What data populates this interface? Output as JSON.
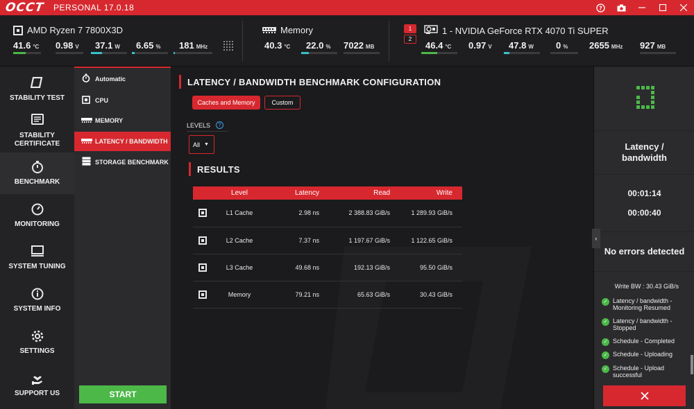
{
  "app": {
    "logo": "OCCT",
    "edition": "PERSONAL 17.0.18"
  },
  "titlebar_icons": [
    "help-icon",
    "camera-icon",
    "minimize-icon",
    "maximize-icon",
    "close-icon"
  ],
  "colors": {
    "accent": "#d7282f",
    "green": "#4cb848",
    "cyan": "#39c2c9",
    "blue_help": "#3aa0e8"
  },
  "hw": {
    "cpu": {
      "name": "AMD Ryzen 7 7800X3D",
      "metrics": [
        {
          "value": "41.6",
          "unit": "°C",
          "fill": 0.45,
          "color": "#4cb848"
        },
        {
          "value": "0.98",
          "unit": "V",
          "fill": 0.0,
          "color": "#39c2c9"
        },
        {
          "value": "37.1",
          "unit": "W",
          "fill": 0.3,
          "color": "#39c2c9"
        },
        {
          "value": "6.65",
          "unit": "%",
          "fill": 0.07,
          "color": "#39c2c9"
        },
        {
          "value": "181",
          "unit": "MHz",
          "fill": 0.04,
          "color": "#39c2c9"
        }
      ]
    },
    "memory": {
      "name": "Memory",
      "metrics": [
        {
          "value": "40.3",
          "unit": "°C",
          "fill": 0.0,
          "color": "#4cb848"
        },
        {
          "value": "22.0",
          "unit": "%",
          "fill": 0.22,
          "color": "#39c2c9"
        },
        {
          "value": "7022",
          "unit": "MB",
          "fill": 0.0,
          "color": "#39c2c9"
        }
      ]
    },
    "gpu": {
      "badges": [
        "1",
        "2"
      ],
      "name": "1 - NVIDIA GeForce RTX 4070 Ti SUPER",
      "metrics": [
        {
          "value": "46.4",
          "unit": "°C",
          "fill": 0.45,
          "color": "#4cb848"
        },
        {
          "value": "0.97",
          "unit": "V",
          "fill": 0.0,
          "color": "#39c2c9"
        },
        {
          "value": "47.8",
          "unit": "W",
          "fill": 0.15,
          "color": "#39c2c9"
        },
        {
          "value": "0",
          "unit": "%",
          "fill": 0.0,
          "color": "#39c2c9"
        },
        {
          "value": "2655",
          "unit": "MHz",
          "fill": 0.0,
          "color": "#39c2c9"
        },
        {
          "value": "927",
          "unit": "MB",
          "fill": 0.0,
          "color": "#39c2c9"
        }
      ]
    }
  },
  "leftnav": [
    {
      "label": "STABILITY TEST",
      "icon": "stability-test-icon"
    },
    {
      "label": "STABILITY CERTIFICATE",
      "icon": "certificate-icon"
    },
    {
      "label": "BENCHMARK",
      "icon": "stopwatch-icon",
      "active": true
    },
    {
      "label": "MONITORING",
      "icon": "gauge-icon"
    },
    {
      "label": "SYSTEM TUNING",
      "icon": "monitor-icon"
    },
    {
      "label": "SYSTEM INFO",
      "icon": "info-icon"
    },
    {
      "label": "SETTINGS",
      "icon": "gear-icon"
    },
    {
      "label": "SUPPORT US",
      "icon": "heart-hand-icon"
    }
  ],
  "subnav": [
    {
      "label": "Automatic",
      "icon": "stopwatch-icon"
    },
    {
      "label": "CPU",
      "icon": "cpu-icon"
    },
    {
      "label": "MEMORY",
      "icon": "memory-icon"
    },
    {
      "label": "LATENCY / BANDWIDTH",
      "icon": "memory-icon",
      "active": true
    },
    {
      "label": "STORAGE BENCHMARK",
      "icon": "storage-icon"
    }
  ],
  "start_label": "START",
  "main": {
    "title": "LATENCY / BANDWIDTH BENCHMARK CONFIGURATION",
    "tabs": [
      "Caches and Memory",
      "Custom"
    ],
    "levels_label": "LEVELS",
    "levels_value": "All",
    "results_title": "RESULTS",
    "table": {
      "headers": [
        "",
        "Level",
        "Latency",
        "Read",
        "Write"
      ],
      "rows": [
        [
          "L1 Cache",
          "2.98 ns",
          "2 388.83 GiB/s",
          "1 289.93 GiB/s"
        ],
        [
          "L2 Cache",
          "7.37 ns",
          "1 197.67 GiB/s",
          "1 122.65 GiB/s"
        ],
        [
          "L3 Cache",
          "49.68 ns",
          "192.13 GiB/s",
          "95.50 GiB/s"
        ],
        [
          "Memory",
          "79.21 ns",
          "65.63 GiB/s",
          "30.43 GiB/s"
        ]
      ]
    }
  },
  "right": {
    "test_name_line1": "Latency /",
    "test_name_line2": "bandwidth",
    "timer1": "00:01:14",
    "timer2": "00:00:40",
    "status": "No errors detected",
    "log_head": "Write BW : 30.43 GiB/s",
    "log": [
      "Latency / bandwidth - Monitoring Resumed",
      "Latency / bandwidth - Stopped",
      "Schedule - Completed",
      "Schedule - Uploading",
      "Schedule - Upload successful"
    ]
  }
}
